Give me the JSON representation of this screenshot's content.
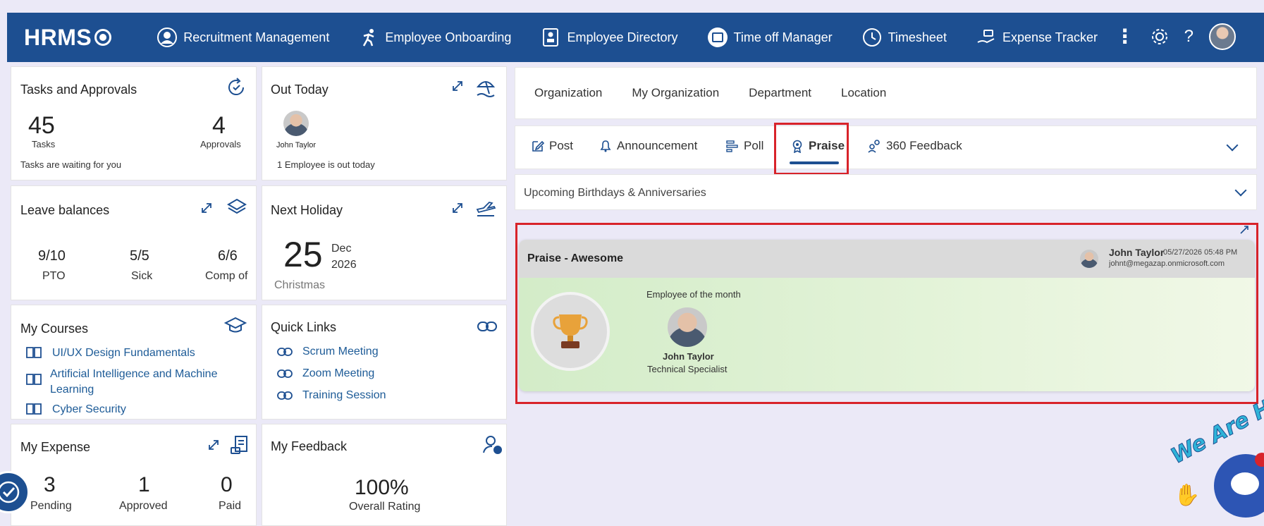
{
  "app": {
    "logo": "HRMS",
    "nav": [
      {
        "label": "Recruitment Management",
        "icon": "person-circle-icon"
      },
      {
        "label": "Employee Onboarding",
        "icon": "runner-icon"
      },
      {
        "label": "Employee Directory",
        "icon": "directory-icon"
      },
      {
        "label": "Time off Manager",
        "icon": "calendar-icon"
      },
      {
        "label": "Timesheet",
        "icon": "clock-icon"
      },
      {
        "label": "Expense Tracker",
        "icon": "money-hand-icon"
      }
    ]
  },
  "tasks": {
    "title": "Tasks and Approvals",
    "tasks_count": "45",
    "tasks_label": "Tasks",
    "approvals_count": "4",
    "approvals_label": "Approvals",
    "note": "Tasks are waiting for you"
  },
  "out_today": {
    "title": "Out Today",
    "person": "John Taylor",
    "note": "1 Employee is out today"
  },
  "leave": {
    "title": "Leave balances",
    "items": [
      {
        "value": "9/10",
        "label": "PTO"
      },
      {
        "value": "5/5",
        "label": "Sick"
      },
      {
        "value": "6/6",
        "label": "Comp of"
      }
    ]
  },
  "holiday": {
    "title": "Next Holiday",
    "day": "25",
    "month": "Dec",
    "year": "2026",
    "name": "Christmas"
  },
  "courses": {
    "title": "My Courses",
    "items": [
      "UI/UX Design Fundamentals",
      "Artificial Intelligence and Machine Learning",
      "Cyber Security"
    ]
  },
  "quick_links": {
    "title": "Quick Links",
    "items": [
      "Scrum Meeting",
      "Zoom Meeting",
      "Training Session"
    ]
  },
  "expense": {
    "title": "My Expense",
    "items": [
      {
        "value": "3",
        "label": "Pending"
      },
      {
        "value": "1",
        "label": "Approved"
      },
      {
        "value": "0",
        "label": "Paid"
      }
    ]
  },
  "feedback": {
    "title": "My Feedback",
    "value": "100%",
    "label": "Overall Rating"
  },
  "org_tabs": [
    "Organization",
    "My Organization",
    "Department",
    "Location"
  ],
  "post_tabs": {
    "post": "Post",
    "announcement": "Announcement",
    "poll": "Poll",
    "praise": "Praise",
    "feedback360": "360 Feedback"
  },
  "birthdays": {
    "label": "Upcoming Birthdays & Anniversaries"
  },
  "praise_card": {
    "title": "Praise - Awesome",
    "author": "John Taylor",
    "timestamp": "05/27/2026 05:48 PM",
    "email": "johnt@megazap.onmicrosoft.com",
    "subtitle": "Employee of the month",
    "employee_name": "John Taylor",
    "employee_role": "Technical Specialist"
  },
  "chat": {
    "banner": "We Are H"
  },
  "colors": {
    "brand": "#1d4f91",
    "highlight": "#d8232a",
    "link": "#1d5b97"
  }
}
